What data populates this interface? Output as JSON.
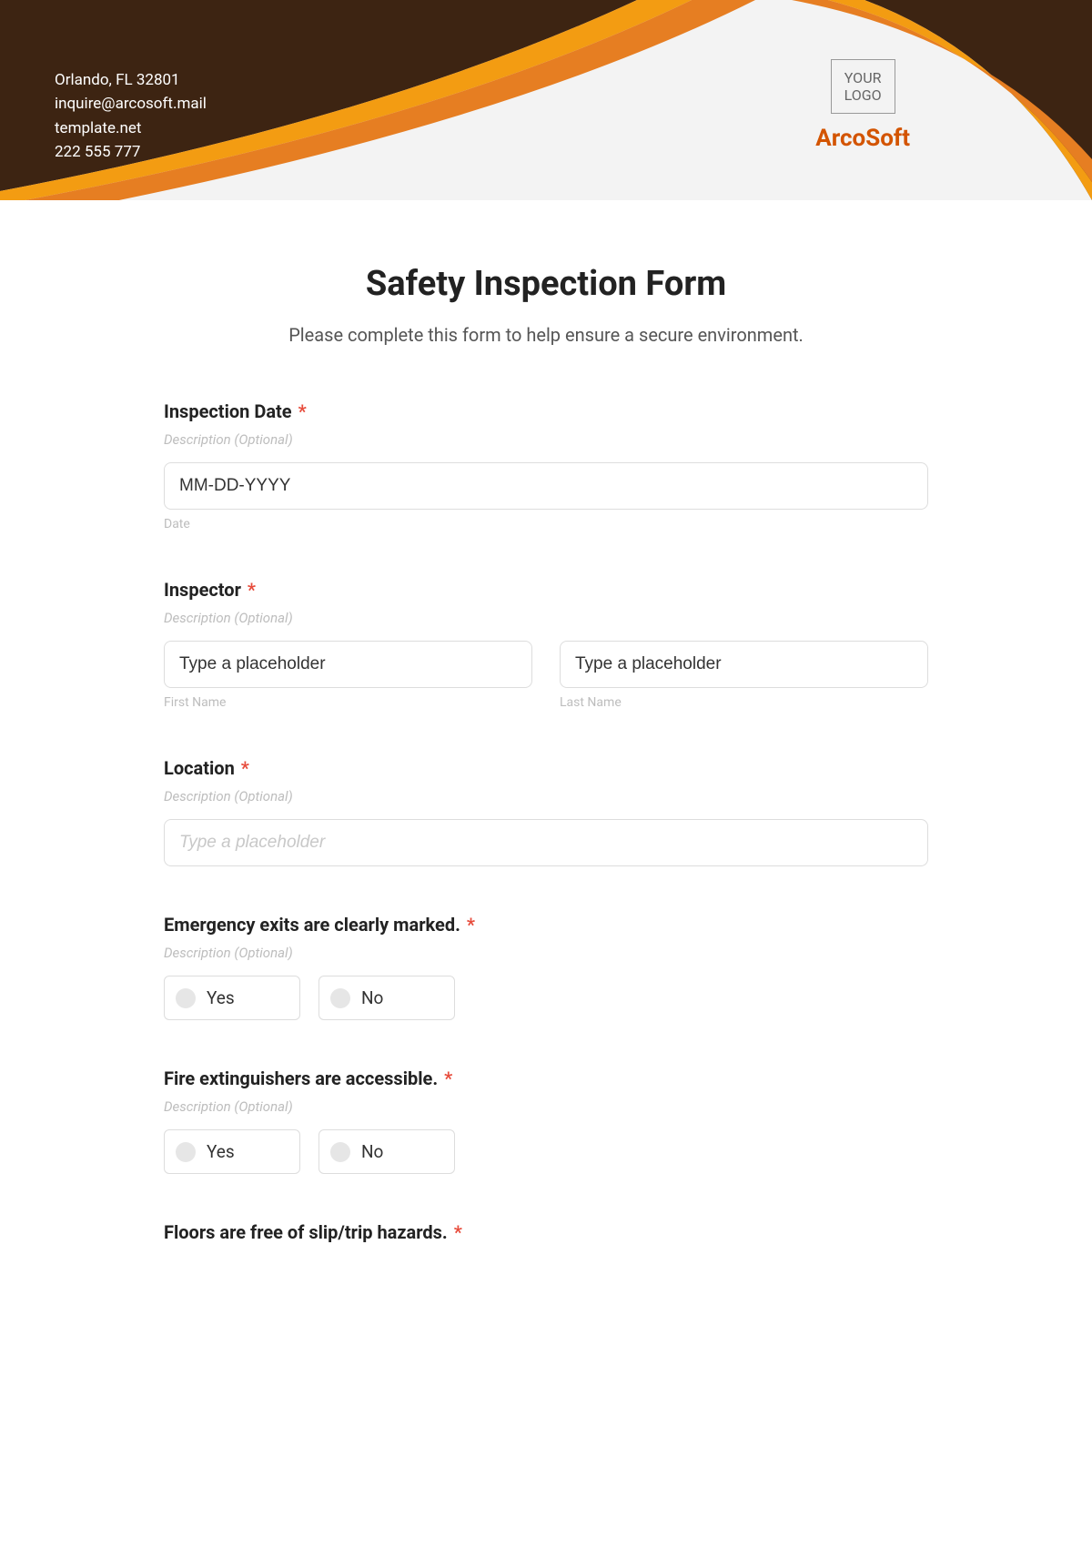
{
  "header": {
    "contact": {
      "address": "Orlando, FL 32801",
      "email": "inquire@arcosoft.mail",
      "website": "template.net",
      "phone": "222 555 777"
    },
    "logo_placeholder_line1": "YOUR",
    "logo_placeholder_line2": "LOGO",
    "brand": "ArcoSoft"
  },
  "form": {
    "title": "Safety Inspection Form",
    "subtitle": "Please complete this form to help ensure a secure environment.",
    "desc_placeholder": "Description (Optional)",
    "required_mark": "*",
    "fields": {
      "inspection_date": {
        "label": "Inspection Date",
        "placeholder": "MM-DD-YYYY",
        "sub": "Date"
      },
      "inspector": {
        "label": "Inspector",
        "first_placeholder": "Type a placeholder",
        "first_sub": "First Name",
        "last_placeholder": "Type a placeholder",
        "last_sub": "Last Name"
      },
      "location": {
        "label": "Location",
        "placeholder": "Type a placeholder"
      },
      "q_exits": {
        "label": "Emergency exits are clearly marked.",
        "yes": "Yes",
        "no": "No"
      },
      "q_fire": {
        "label": "Fire extinguishers are accessible.",
        "yes": "Yes",
        "no": "No"
      },
      "q_floors": {
        "label": "Floors are free of slip/trip hazards."
      }
    }
  }
}
